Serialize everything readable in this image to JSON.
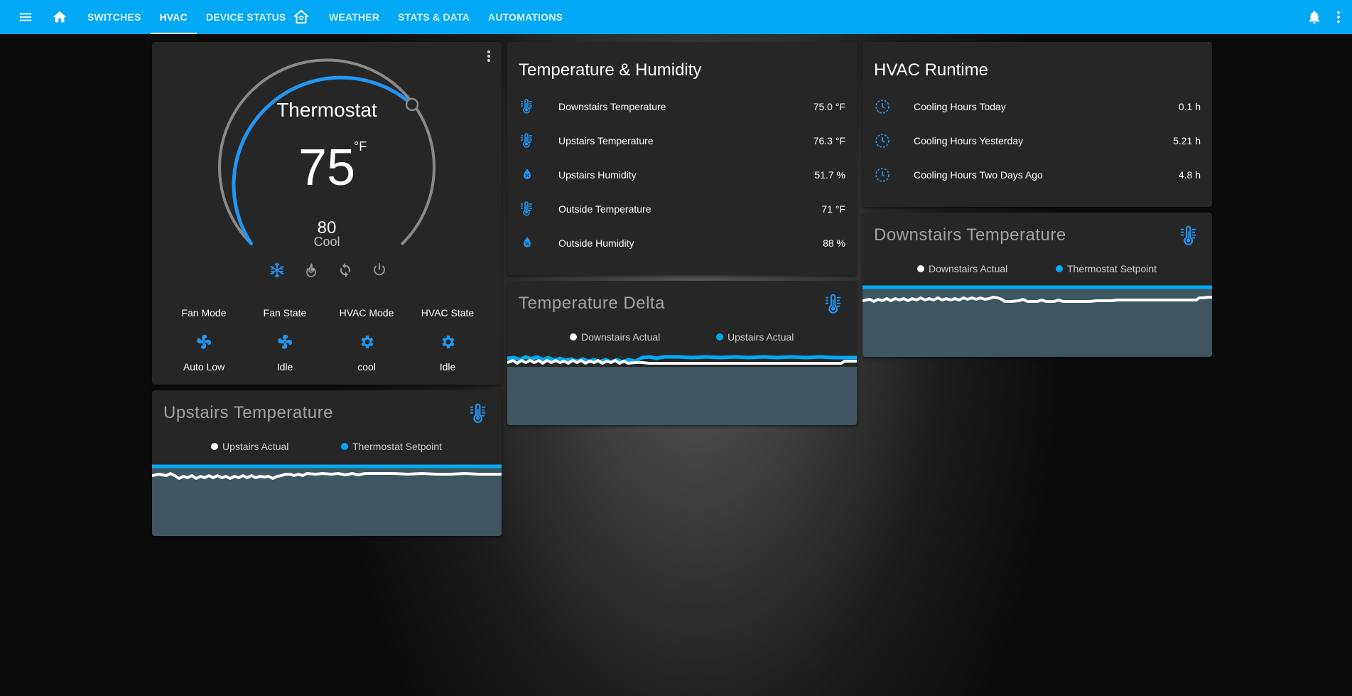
{
  "topbar": {
    "tabs": [
      {
        "label": "SWITCHES"
      },
      {
        "label": "HVAC"
      },
      {
        "label": "DEVICE STATUS"
      },
      {
        "label": "WEATHER"
      },
      {
        "label": "STATS & DATA"
      },
      {
        "label": "AUTOMATIONS"
      }
    ],
    "active_tab": "HVAC",
    "accent_color": "#03a9f4"
  },
  "thermostat": {
    "name": "Thermostat",
    "current": "75",
    "unit": "°F",
    "target": "80",
    "mode_label": "Cool",
    "mode_icons": [
      "snowflake-icon",
      "fire-icon",
      "autorenew-icon",
      "power-icon"
    ],
    "attributes": [
      {
        "label": "Fan Mode",
        "icon": "fan-icon",
        "value": "Auto Low"
      },
      {
        "label": "Fan State",
        "icon": "fan-icon",
        "value": "Idle"
      },
      {
        "label": "HVAC Mode",
        "icon": "gear-icon",
        "value": "cool"
      },
      {
        "label": "HVAC State",
        "icon": "gear-icon",
        "value": "Idle"
      }
    ]
  },
  "temp_humidity": {
    "title": "Temperature & Humidity",
    "rows": [
      {
        "icon": "thermometer-lines-icon",
        "name": "Downstairs Temperature",
        "value": "75.0 °F"
      },
      {
        "icon": "thermometer-lines-icon",
        "name": "Upstairs Temperature",
        "value": "76.3 °F"
      },
      {
        "icon": "water-percent-icon",
        "name": "Upstairs Humidity",
        "value": "51.7 %"
      },
      {
        "icon": "thermometer-lines-icon",
        "name": "Outside Temperature",
        "value": "71 °F"
      },
      {
        "icon": "water-percent-icon",
        "name": "Outside Humidity",
        "value": "88 %"
      }
    ]
  },
  "hvac_runtime": {
    "title": "HVAC Runtime",
    "rows": [
      {
        "icon": "clock-outline-icon",
        "name": "Cooling Hours Today",
        "value": "0.1 h"
      },
      {
        "icon": "clock-outline-icon",
        "name": "Cooling Hours Yesterday",
        "value": "5.21 h"
      },
      {
        "icon": "clock-outline-icon",
        "name": "Cooling Hours Two Days Ago",
        "value": "4.8 h"
      }
    ]
  },
  "graphs": {
    "downstairs": {
      "title": "Downstairs Temperature",
      "legend": [
        "Downstairs Actual",
        "Thermostat Setpoint"
      ]
    },
    "delta": {
      "title": "Temperature Delta",
      "legend": [
        "Downstairs Actual",
        "Upstairs Actual"
      ]
    },
    "upstairs": {
      "title": "Upstairs Temperature",
      "legend": [
        "Upstairs Actual",
        "Thermostat Setpoint"
      ]
    },
    "series_colors": {
      "white": "#ffffff",
      "blue": "#03a9f4"
    },
    "fill_color": "#3f5560"
  }
}
